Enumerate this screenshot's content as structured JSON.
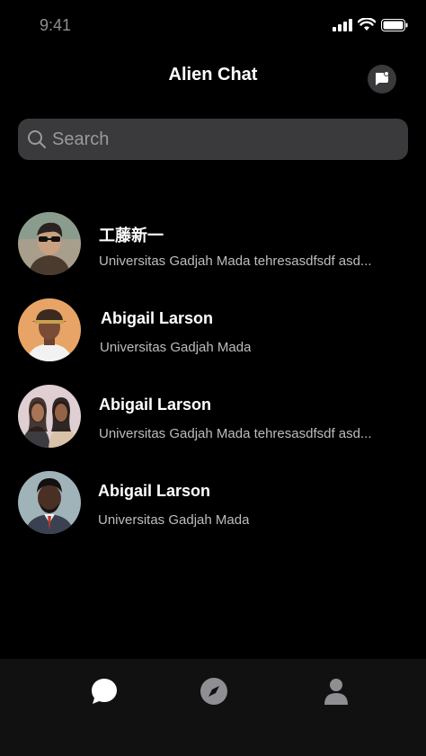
{
  "status_bar": {
    "time": "9:41"
  },
  "header": {
    "title": "Alien Chat"
  },
  "search": {
    "placeholder": "Search"
  },
  "chats": [
    {
      "name": "工藤新一",
      "preview": "Universitas Gadjah Mada tehresasdfsdf asd..."
    },
    {
      "name": "Abigail Larson",
      "preview": "Universitas Gadjah Mada"
    },
    {
      "name": "Abigail Larson",
      "preview": "Universitas Gadjah Mada tehresasdfsdf asd..."
    },
    {
      "name": "Abigail Larson",
      "preview": "Universitas Gadjah Mada"
    }
  ],
  "tabs": [
    {
      "icon": "chat-bubble-icon",
      "active": true
    },
    {
      "icon": "compass-icon",
      "active": false
    },
    {
      "icon": "person-icon",
      "active": false
    }
  ],
  "colors": {
    "background": "#000000",
    "surface": "#3a3a3c",
    "tab_bar": "#111111",
    "inactive_icon": "#8e8e93",
    "active_icon": "#ffffff"
  }
}
